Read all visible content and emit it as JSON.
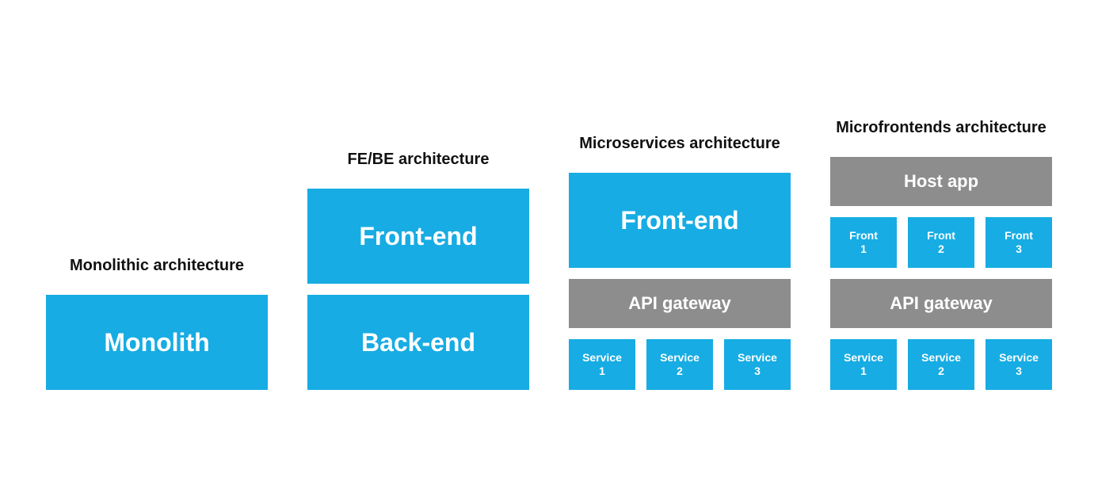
{
  "colors": {
    "blue": "#17ace3",
    "gray": "#8d8d8d"
  },
  "columns": [
    {
      "title": "Monolithic architecture",
      "monolith": "Monolith"
    },
    {
      "title": "FE/BE architecture",
      "frontend": "Front-end",
      "backend": "Back-end"
    },
    {
      "title": "Microservices architecture",
      "frontend": "Front-end",
      "gateway": "API gateway",
      "services": [
        {
          "line1": "Service",
          "line2": "1"
        },
        {
          "line1": "Service",
          "line2": "2"
        },
        {
          "line1": "Service",
          "line2": "3"
        }
      ]
    },
    {
      "title": "Microfrontends architecture",
      "host": "Host app",
      "fronts": [
        {
          "line1": "Front",
          "line2": "1"
        },
        {
          "line1": "Front",
          "line2": "2"
        },
        {
          "line1": "Front",
          "line2": "3"
        }
      ],
      "gateway": "API gateway",
      "services": [
        {
          "line1": "Service",
          "line2": "1"
        },
        {
          "line1": "Service",
          "line2": "2"
        },
        {
          "line1": "Service",
          "line2": "3"
        }
      ]
    }
  ]
}
